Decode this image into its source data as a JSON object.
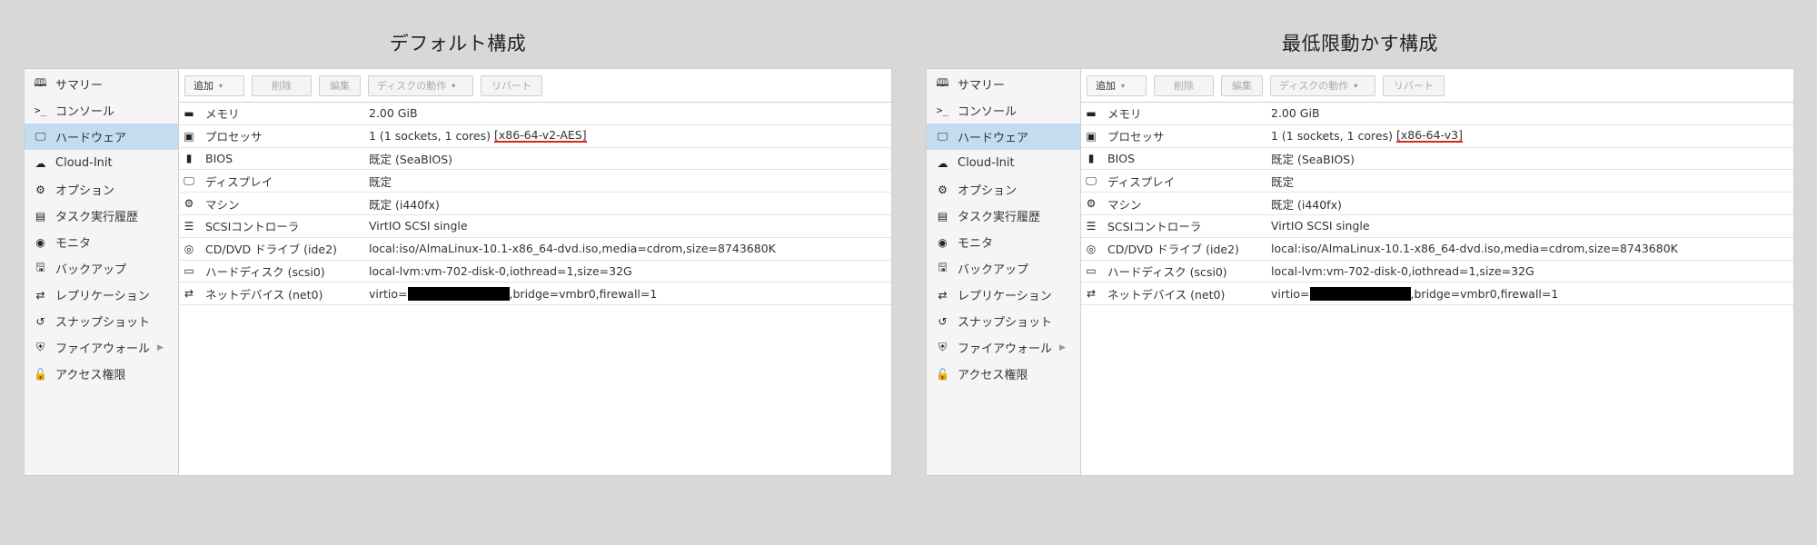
{
  "panels": [
    {
      "title": "デフォルト構成",
      "toolbar": {
        "add": "追加",
        "delete": "削除",
        "edit": "編集",
        "disk_action": "ディスクの動作",
        "revert": "リバート"
      },
      "sidebar": [
        {
          "icon": "book-icon",
          "label": "サマリー"
        },
        {
          "icon": "terminal-icon",
          "label": "コンソール"
        },
        {
          "icon": "monitor-icon",
          "label": "ハードウェア"
        },
        {
          "icon": "cloud-icon",
          "label": "Cloud-Init"
        },
        {
          "icon": "gear-icon",
          "label": "オプション"
        },
        {
          "icon": "list-icon",
          "label": "タスク実行履歴"
        },
        {
          "icon": "eye-icon",
          "label": "モニタ"
        },
        {
          "icon": "floppy-icon",
          "label": "バックアップ"
        },
        {
          "icon": "retweet-icon",
          "label": "レプリケーション"
        },
        {
          "icon": "history-icon",
          "label": "スナップショット"
        },
        {
          "icon": "shield-icon",
          "label": "ファイアウォール"
        },
        {
          "icon": "unlock-icon",
          "label": "アクセス権限"
        }
      ],
      "rows": [
        {
          "icon": "memory-icon",
          "label": "メモリ",
          "value": "2.00 GiB"
        },
        {
          "icon": "cpu-icon",
          "label": "プロセッサ",
          "value_prefix": "1 (1 sockets, 1 cores) ",
          "value_highlight": "[x86-64-v2-AES]"
        },
        {
          "icon": "bios-icon",
          "label": "BIOS",
          "value": "既定 (SeaBIOS)"
        },
        {
          "icon": "desktop-icon",
          "label": "ディスプレイ",
          "value": "既定"
        },
        {
          "icon": "cogs-icon",
          "label": "マシン",
          "value": "既定 (i440fx)"
        },
        {
          "icon": "database-icon",
          "label": "SCSIコントローラ",
          "value": "VirtIO SCSI single"
        },
        {
          "icon": "cdrom-icon",
          "label": "CD/DVD ドライブ (ide2)",
          "value": "local:iso/AlmaLinux-10.1-x86_64-dvd.iso,media=cdrom,size=8743680K"
        },
        {
          "icon": "hdd-icon",
          "label": "ハードディスク (scsi0)",
          "value": "local-lvm:vm-702-disk-0,iothread=1,size=32G"
        },
        {
          "icon": "exchange-icon",
          "label": "ネットデバイス (net0)",
          "value_prefix": "virtio=",
          "value_suffix": ",bridge=vmbr0,firewall=1"
        }
      ]
    },
    {
      "title": "最低限動かす構成",
      "toolbar": {
        "add": "追加",
        "delete": "削除",
        "edit": "編集",
        "disk_action": "ディスクの動作",
        "revert": "リバート"
      },
      "sidebar": [
        {
          "icon": "book-icon",
          "label": "サマリー"
        },
        {
          "icon": "terminal-icon",
          "label": "コンソール"
        },
        {
          "icon": "monitor-icon",
          "label": "ハードウェア"
        },
        {
          "icon": "cloud-icon",
          "label": "Cloud-Init"
        },
        {
          "icon": "gear-icon",
          "label": "オプション"
        },
        {
          "icon": "list-icon",
          "label": "タスク実行履歴"
        },
        {
          "icon": "eye-icon",
          "label": "モニタ"
        },
        {
          "icon": "floppy-icon",
          "label": "バックアップ"
        },
        {
          "icon": "retweet-icon",
          "label": "レプリケーション"
        },
        {
          "icon": "history-icon",
          "label": "スナップショット"
        },
        {
          "icon": "shield-icon",
          "label": "ファイアウォール"
        },
        {
          "icon": "unlock-icon",
          "label": "アクセス権限"
        }
      ],
      "rows": [
        {
          "icon": "memory-icon",
          "label": "メモリ",
          "value": "2.00 GiB"
        },
        {
          "icon": "cpu-icon",
          "label": "プロセッサ",
          "value_prefix": "1 (1 sockets, 1 cores) ",
          "value_highlight": "[x86-64-v3]"
        },
        {
          "icon": "bios-icon",
          "label": "BIOS",
          "value": "既定 (SeaBIOS)"
        },
        {
          "icon": "desktop-icon",
          "label": "ディスプレイ",
          "value": "既定"
        },
        {
          "icon": "cogs-icon",
          "label": "マシン",
          "value": "既定 (i440fx)"
        },
        {
          "icon": "database-icon",
          "label": "SCSIコントローラ",
          "value": "VirtIO SCSI single"
        },
        {
          "icon": "cdrom-icon",
          "label": "CD/DVD ドライブ (ide2)",
          "value": "local:iso/AlmaLinux-10.1-x86_64-dvd.iso,media=cdrom,size=8743680K"
        },
        {
          "icon": "hdd-icon",
          "label": "ハードディスク (scsi0)",
          "value": "local-lvm:vm-702-disk-0,iothread=1,size=32G"
        },
        {
          "icon": "exchange-icon",
          "label": "ネットデバイス (net0)",
          "value_prefix": "virtio=",
          "value_suffix": ",bridge=vmbr0,firewall=1"
        }
      ]
    }
  ],
  "colors": {
    "background": "#d8d8d8",
    "active_item": "#c3dcf0",
    "highlight_underline": "#d9251b",
    "redaction": "#000000"
  }
}
